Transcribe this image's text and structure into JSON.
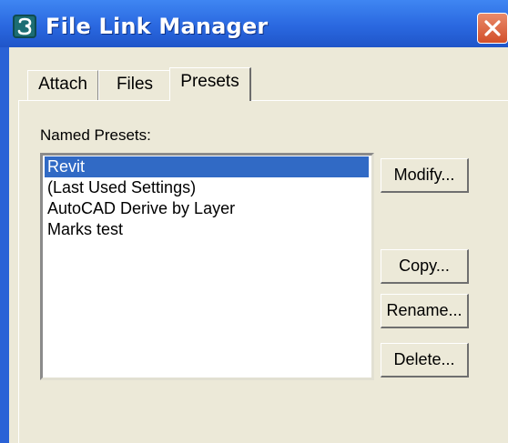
{
  "window": {
    "title": "File Link Manager",
    "app_icon": "3dsmax-logo-icon",
    "close_icon": "close-icon"
  },
  "tabs": [
    {
      "label": "Attach",
      "selected": false
    },
    {
      "label": "Files",
      "selected": false
    },
    {
      "label": "Presets",
      "selected": true
    }
  ],
  "presets": {
    "label": "Named Presets:",
    "items": [
      {
        "label": "Revit",
        "selected": true
      },
      {
        "label": "(Last Used Settings)",
        "selected": false
      },
      {
        "label": "AutoCAD Derive by Layer",
        "selected": false
      },
      {
        "label": "Marks test",
        "selected": false
      }
    ],
    "buttons": {
      "modify": "Modify...",
      "copy": "Copy...",
      "rename": "Rename...",
      "delete": "Delete..."
    }
  },
  "colors": {
    "titlebar": "#2a68e0",
    "dialog_bg": "#ece9d8",
    "selection": "#316ac5",
    "close_button": "#d24f2a"
  }
}
